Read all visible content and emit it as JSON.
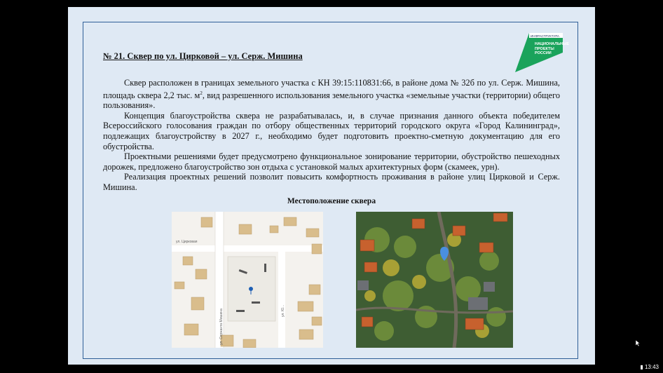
{
  "slide": {
    "title": "№ 21. Сквер по ул. Цирковой – ул. Серж. Мишина",
    "paragraph1_a": "Сквер расположен в границах земельного участка с КН 39:15:110831:66, в районе дома № 32б по ул. Серж. Мишина, площадь сквера 2,2 тыс. м",
    "paragraph1_sup": "2",
    "paragraph1_b": ", вид разрешенного использования земельного участка «земельные участки (территории) общего пользования».",
    "paragraph2": "Концепция благоустройства сквера не разрабатывалась, и, в случае признания данного объекта победителем Всероссийского голосования граждан по отбору общественных территорий городского округа «Город Калининград», подлежащих благоустройству в 2027 г., необходимо будет подготовить проектно-сметную документацию для его обустройства.",
    "paragraph3": "Проектными решениями будет предусмотрено функциональное зонирование территории, обустройство пешеходных дорожек, предложено благоустройство зон отдыха с установкой малых архитектурных форм (скамеек, урн).",
    "paragraph4": "Реализация проектных решений позволит повысить комфортность проживания в районе улиц Цирковой и Серж. Мишина.",
    "caption": "Местоположение сквера"
  },
  "logo": {
    "line1": "ИНФРАСТРУКТУРА",
    "line2": "НАЦИОНАЛЬНЫЕ ПРОЕКТЫ РОССИИ",
    "color": "#1aa35b"
  },
  "map": {
    "street_circus": "ул. Цирковая",
    "street_mishina": "ул. Сержанта Мишина",
    "street_bolotnaya": "ул. Ю...",
    "marker_color": "#1e5fb4"
  },
  "satellite": {
    "marker_color": "#4a8fe0"
  },
  "status": {
    "clock": "13:43"
  }
}
